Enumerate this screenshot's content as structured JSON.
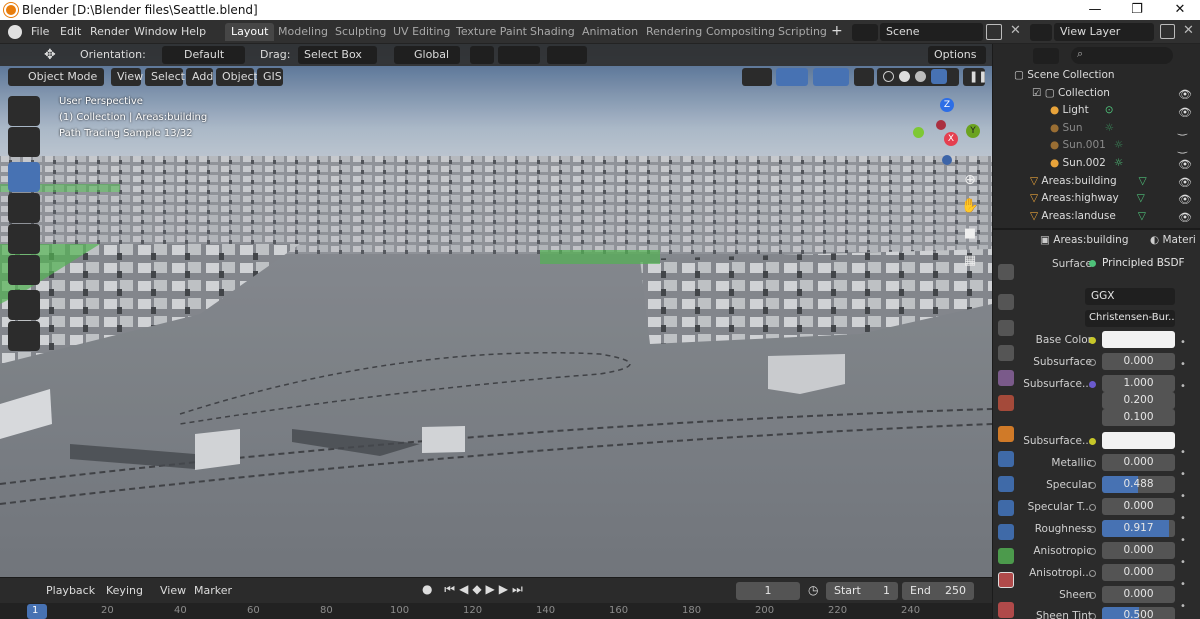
{
  "window": {
    "title": "Blender [D:\\Blender files\\Seattle.blend]",
    "minimize": "—",
    "maximize": "❐",
    "close": "✕"
  },
  "menu": [
    "File",
    "Edit",
    "Render",
    "Window",
    "Help"
  ],
  "workspaces": [
    "Layout",
    "Modeling",
    "Sculpting",
    "UV Editing",
    "Texture Paint",
    "Shading",
    "Animation",
    "Rendering",
    "Compositing",
    "Scripting"
  ],
  "active_workspace": "Layout",
  "scene": "Scene",
  "view_layer": "View Layer",
  "tool_header": {
    "orientation_label": "Orientation:",
    "orientation": "Default",
    "drag_label": "Drag:",
    "drag": "Select Box",
    "transform": "Global",
    "options": "Options"
  },
  "view_header": {
    "mode": "Object Mode",
    "items": [
      "View",
      "Select",
      "Add",
      "Object",
      "GIS"
    ]
  },
  "overlay": {
    "line1": "User Perspective",
    "line2": "(1) Collection | Areas:building",
    "line3": "Path Tracing Sample 13/32"
  },
  "gizmo": {
    "z": "Z",
    "y": "Y",
    "x": "X"
  },
  "outliner": {
    "items": [
      {
        "label": "Scene Collection",
        "dim": false
      },
      {
        "label": "Collection",
        "dim": false
      },
      {
        "label": "Light",
        "dim": false
      },
      {
        "label": "Sun",
        "dim": true
      },
      {
        "label": "Sun.001",
        "dim": true
      },
      {
        "label": "Sun.002",
        "dim": false
      },
      {
        "label": "Areas:building",
        "dim": false
      },
      {
        "label": "Areas:highway",
        "dim": false
      },
      {
        "label": "Areas:landuse",
        "dim": false
      }
    ]
  },
  "properties": {
    "object": "Areas:building",
    "material_tab": "Materi",
    "surface_label": "Surface",
    "surface": "Principled BSDF",
    "distribution": "GGX",
    "subsurface_method": "Christensen-Bur...",
    "rows": [
      {
        "label": "Base Color",
        "value": "",
        "fill": 0,
        "swatch": true
      },
      {
        "label": "Subsurface",
        "value": "0.000",
        "fill": 0
      },
      {
        "label": "Subsurface...",
        "value": "1.000",
        "fill": 0
      },
      {
        "label": "",
        "value": "0.200",
        "fill": 0
      },
      {
        "label": "",
        "value": "0.100",
        "fill": 0
      },
      {
        "label": "Subsurface...",
        "value": "",
        "fill": 0,
        "swatch": true
      },
      {
        "label": "Metallic",
        "value": "0.000",
        "fill": 0
      },
      {
        "label": "Specular",
        "value": "0.488",
        "fill": 0.488
      },
      {
        "label": "Specular T...",
        "value": "0.000",
        "fill": 0
      },
      {
        "label": "Roughness",
        "value": "0.917",
        "fill": 0.917
      },
      {
        "label": "Anisotropic",
        "value": "0.000",
        "fill": 0
      },
      {
        "label": "Anisotropi...",
        "value": "0.000",
        "fill": 0
      },
      {
        "label": "Sheen",
        "value": "0.000",
        "fill": 0
      },
      {
        "label": "Sheen Tint",
        "value": "0.500",
        "fill": 0.5
      }
    ]
  },
  "timeline": {
    "menus": [
      "Playback",
      "Keying",
      "View",
      "Marker"
    ],
    "current_frame": "1",
    "start_label": "Start",
    "start": "1",
    "end_label": "End",
    "end": "250",
    "ticks": [
      "1",
      "20",
      "40",
      "60",
      "80",
      "100",
      "120",
      "140",
      "160",
      "180",
      "200",
      "220",
      "240"
    ]
  },
  "colors": {
    "accent": "#4772b3",
    "header": "#303030",
    "panel": "#2b2b2b"
  }
}
